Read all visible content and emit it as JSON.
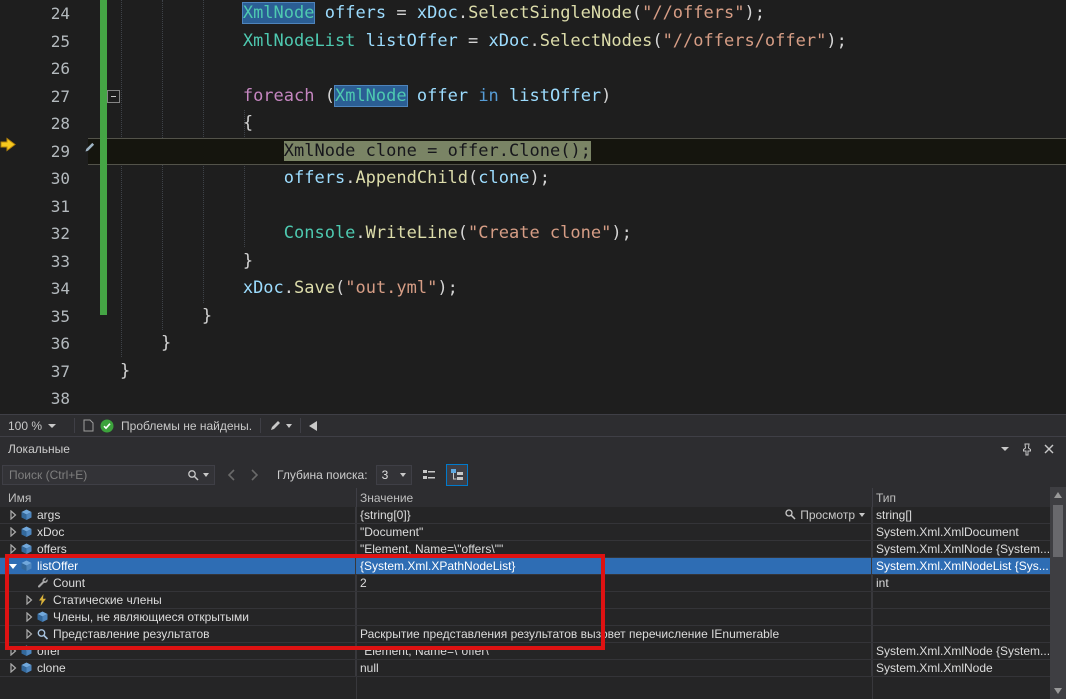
{
  "editor": {
    "zoom_level": "100 %",
    "problems_status": "Проблемы не найдены.",
    "current_line": 29,
    "lines": [
      {
        "n": 24,
        "ind": 12,
        "tok": [
          [
            "XmlNode",
            "ty",
            "ref"
          ],
          [
            " ",
            "pl"
          ],
          [
            "offers",
            "va"
          ],
          [
            " = ",
            "pl"
          ],
          [
            "xDoc",
            "va"
          ],
          [
            ".",
            "pl"
          ],
          [
            "SelectSingleNode",
            "me"
          ],
          [
            "(",
            "pl"
          ],
          [
            "\"//offers\"",
            "st"
          ],
          [
            ");",
            "pl"
          ]
        ]
      },
      {
        "n": 25,
        "ind": 12,
        "tok": [
          [
            "XmlNodeList",
            "ty"
          ],
          [
            " ",
            "pl"
          ],
          [
            "listOffer",
            "va"
          ],
          [
            " = ",
            "pl"
          ],
          [
            "xDoc",
            "va"
          ],
          [
            ".",
            "pl"
          ],
          [
            "SelectNodes",
            "me"
          ],
          [
            "(",
            "pl"
          ],
          [
            "\"//offers/offer\"",
            "st"
          ],
          [
            ");",
            "pl"
          ]
        ]
      },
      {
        "n": 26,
        "ind": 0,
        "tok": []
      },
      {
        "n": 27,
        "ind": 12,
        "tok": [
          [
            "foreach",
            "kw"
          ],
          [
            " (",
            "pl"
          ],
          [
            "XmlNode",
            "ty",
            "ref"
          ],
          [
            " ",
            "pl"
          ],
          [
            "offer",
            "va"
          ],
          [
            " ",
            "pl"
          ],
          [
            "in",
            "kw2"
          ],
          [
            " ",
            "pl"
          ],
          [
            "listOffer",
            "va"
          ],
          [
            ")",
            "pl"
          ]
        ]
      },
      {
        "n": 28,
        "ind": 12,
        "tok": [
          [
            "{",
            "pl"
          ]
        ]
      },
      {
        "n": 29,
        "ind": 16,
        "current": true,
        "tok": [
          [
            "XmlNode",
            "ty"
          ],
          [
            " ",
            "pl"
          ],
          [
            "clone",
            "va"
          ],
          [
            " = ",
            "pl"
          ],
          [
            "offer",
            "va"
          ],
          [
            ".",
            "pl"
          ],
          [
            "Clone",
            "me"
          ],
          [
            "();",
            "pl"
          ]
        ]
      },
      {
        "n": 30,
        "ind": 16,
        "tok": [
          [
            "offers",
            "va"
          ],
          [
            ".",
            "pl"
          ],
          [
            "AppendChild",
            "me"
          ],
          [
            "(",
            "pl"
          ],
          [
            "clone",
            "va"
          ],
          [
            ");",
            "pl"
          ]
        ]
      },
      {
        "n": 31,
        "ind": 0,
        "tok": []
      },
      {
        "n": 32,
        "ind": 16,
        "tok": [
          [
            "Console",
            "ty"
          ],
          [
            ".",
            "pl"
          ],
          [
            "WriteLine",
            "me"
          ],
          [
            "(",
            "pl"
          ],
          [
            "\"Create clone\"",
            "st"
          ],
          [
            ");",
            "pl"
          ]
        ]
      },
      {
        "n": 33,
        "ind": 12,
        "tok": [
          [
            "}",
            "pl"
          ]
        ]
      },
      {
        "n": 34,
        "ind": 12,
        "tok": [
          [
            "xDoc",
            "va"
          ],
          [
            ".",
            "pl"
          ],
          [
            "Save",
            "me"
          ],
          [
            "(",
            "pl"
          ],
          [
            "\"out.yml\"",
            "st"
          ],
          [
            ");",
            "pl"
          ]
        ]
      },
      {
        "n": 35,
        "ind": 8,
        "tok": [
          [
            "}",
            "pl"
          ]
        ]
      },
      {
        "n": 36,
        "ind": 4,
        "tok": [
          [
            "}",
            "pl"
          ]
        ]
      },
      {
        "n": 37,
        "ind": 0,
        "tok": [
          [
            "}",
            "pl"
          ]
        ]
      },
      {
        "n": 38,
        "ind": 0,
        "tok": []
      }
    ]
  },
  "locals": {
    "title": "Локальные",
    "search": {
      "placeholder": "Поиск (Ctrl+E)"
    },
    "depth": {
      "label": "Глубина поиска:",
      "value": "3"
    },
    "columns": {
      "name": "Имя",
      "value": "Значение",
      "type": "Тип"
    },
    "view_button_label": "Просмотр",
    "rows": [
      {
        "key": "args",
        "name": "args",
        "value": "{string[0]}",
        "type": "string[]",
        "indent": 0,
        "expander": "collapsed",
        "icon": "field",
        "view": true
      },
      {
        "key": "xdoc",
        "name": "xDoc",
        "value": "\"Document\"",
        "type": "System.Xml.XmlDocument",
        "indent": 0,
        "expander": "collapsed",
        "icon": "field"
      },
      {
        "key": "offers",
        "name": "offers",
        "value": "\"Element, Name=\\\"offers\\\"\"",
        "type": "System.Xml.XmlNode {System...",
        "indent": 0,
        "expander": "collapsed",
        "icon": "field"
      },
      {
        "key": "listoffer",
        "name": "listOffer",
        "value": "{System.Xml.XPathNodeList}",
        "type": "System.Xml.XmlNodeList {Sys...",
        "indent": 0,
        "expander": "expanded",
        "icon": "field",
        "selected": true
      },
      {
        "key": "count",
        "name": "Count",
        "value": "2",
        "type": "int",
        "indent": 1,
        "expander": "none",
        "icon": "wrench"
      },
      {
        "key": "static-members",
        "name": "Статические члены",
        "value": "",
        "type": "",
        "indent": 1,
        "expander": "collapsed",
        "icon": "lightning"
      },
      {
        "key": "non-public-members",
        "name": "Члены, не являющиеся открытыми",
        "value": "",
        "type": "",
        "indent": 1,
        "expander": "collapsed",
        "icon": "field"
      },
      {
        "key": "results-view",
        "name": "Представление результатов",
        "value": "Раскрытие представления результатов вызовет перечисление IEnumerable",
        "type": "",
        "indent": 1,
        "expander": "collapsed",
        "icon": "results"
      },
      {
        "key": "offer",
        "name": "offer",
        "value": "\"Element, Name=\\\"offer\\\"\"",
        "type": "System.Xml.XmlNode {System...",
        "indent": 0,
        "expander": "collapsed",
        "icon": "field"
      },
      {
        "key": "clone",
        "name": "clone",
        "value": "null",
        "type": "System.Xml.XmlNode",
        "indent": 0,
        "expander": "collapsed",
        "icon": "field"
      }
    ]
  },
  "colors": {
    "accent": "#007ACC",
    "selection": "#2E6DB4",
    "annotation_red": "#DE1212",
    "change_bar_green": "#45A545",
    "status_ok_green": "#3CA23C"
  }
}
